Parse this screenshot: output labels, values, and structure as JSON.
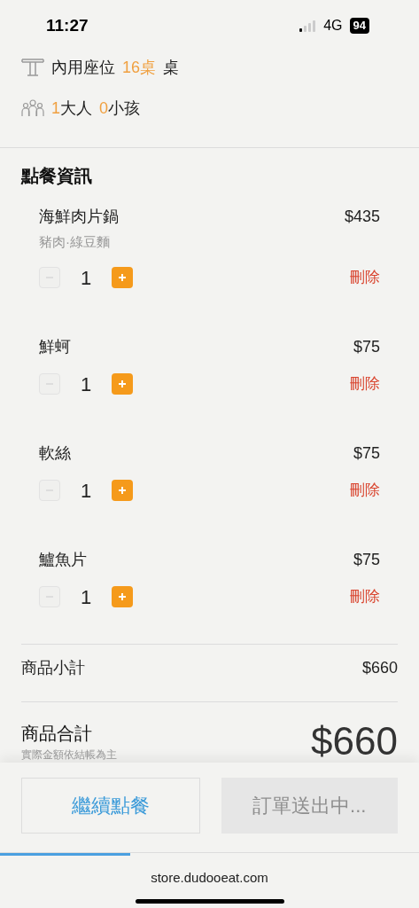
{
  "status_bar": {
    "time": "11:27",
    "network": "4G",
    "battery": "94"
  },
  "seating": {
    "label": "內用座位",
    "table": "16桌",
    "unit": "桌"
  },
  "party": {
    "adults": "1",
    "adults_label": "大人",
    "children": "0",
    "children_label": "小孩"
  },
  "order_section": {
    "title": "點餐資訊"
  },
  "items": [
    {
      "name": "海鮮肉片鍋",
      "options": "豬肉·綠豆麵",
      "price": "$435",
      "quantity": "1",
      "minus_disabled": true,
      "delete": "刪除"
    },
    {
      "name": "鮮蚵",
      "price": "$75",
      "quantity": "1",
      "minus_disabled": true,
      "delete": "刪除"
    },
    {
      "name": "軟絲",
      "price": "$75",
      "quantity": "1",
      "minus_disabled": true,
      "delete": "刪除"
    },
    {
      "name": "鱸魚片",
      "price": "$75",
      "quantity": "1",
      "minus_disabled": true,
      "delete": "刪除"
    }
  ],
  "subtotal": {
    "label": "商品小計",
    "value": "$660"
  },
  "total": {
    "label": "商品合計",
    "note": "實際金額依結帳為主",
    "value": "$660"
  },
  "buttons": [
    {
      "label": "繼續點餐",
      "disabled": false
    },
    {
      "label": "訂單送出中...",
      "disabled": true
    }
  ],
  "page_load": {
    "level": 0.31
  },
  "address_bar": {
    "url": "store.dudooeat.com"
  }
}
